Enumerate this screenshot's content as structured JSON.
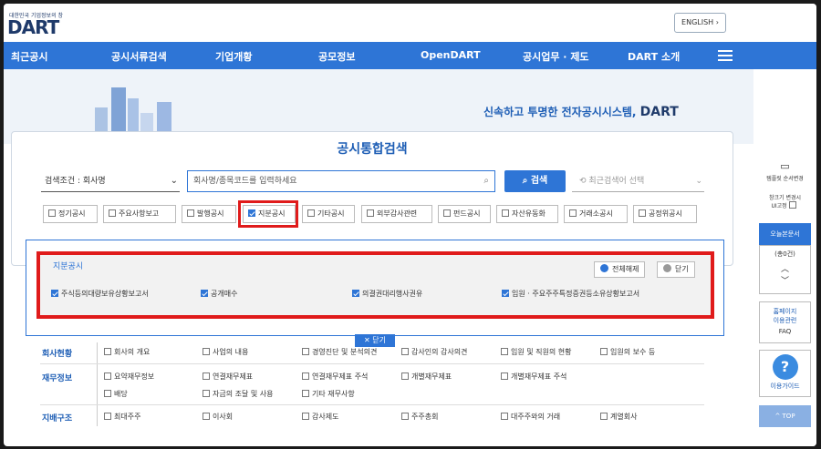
{
  "header": {
    "logo_sub": "대한민국 기업정보의 창",
    "logo": "DART",
    "english_label": "ENGLISH"
  },
  "nav": {
    "items": [
      "최근공시",
      "공시서류검색",
      "기업개황",
      "공모정보",
      "OpenDART",
      "공시업무 · 제도",
      "DART 소개"
    ]
  },
  "hero": {
    "tagline": "신속하고 투명한 전자공시시스템,",
    "tagline_brand": "DART"
  },
  "search": {
    "title": "공시통합검색",
    "condition": "검색조건 : 회사명",
    "placeholder": "회사명/종목코드를 입력하세요",
    "button": "검색",
    "recent": "최근검색어 선택"
  },
  "chips": [
    {
      "label": "정기공시",
      "checked": false
    },
    {
      "label": "주요사항보고",
      "checked": false
    },
    {
      "label": "발행공시",
      "checked": false
    },
    {
      "label": "지분공시",
      "checked": true
    },
    {
      "label": "기타공시",
      "checked": false
    },
    {
      "label": "외부감사관련",
      "checked": false
    },
    {
      "label": "펀드공시",
      "checked": false
    },
    {
      "label": "자산유동화",
      "checked": false
    },
    {
      "label": "거래소공시",
      "checked": false
    },
    {
      "label": "공정위공시",
      "checked": false
    }
  ],
  "sub_panel": {
    "title": "지분공시",
    "select_all": "전체해제",
    "close": "닫기",
    "items": [
      "주식등의대량보유상황보고서",
      "공개매수",
      "의결권대리행사권유",
      "임원 · 주요주주특정증권등소유상황보고서"
    ]
  },
  "close_label": "닫기",
  "grid": {
    "rows": [
      {
        "label": "회사현황",
        "items": [
          "회사의 개요",
          "사업의 내용",
          "경영진단 및 분석의견",
          "감사인의 감사의견",
          "임원 및 직원의 현황",
          "임원의 보수 등"
        ]
      },
      {
        "label": "재무정보",
        "items": [
          "요약재무정보",
          "연결재무제표",
          "연결재무제표 주석",
          "개별재무제표",
          "개별재무제표 주석",
          "배당",
          "자금의 조달 및 사용",
          "기타 재무사항"
        ]
      },
      {
        "label": "지배구조",
        "items": [
          "최대주주",
          "이사회",
          "감사제도",
          "주주총회",
          "대주주와의 거래",
          "계열회사"
        ]
      }
    ]
  },
  "side": {
    "template": "템플릿 순서변경",
    "window": "창크기 변경시",
    "ui_fixed": "UI고정",
    "today": "오늘본문서",
    "today_count": "(총0건)",
    "homepage1": "홈페이지",
    "homepage2": "이용관련",
    "faq": "FAQ",
    "guide": "이용가이드",
    "top": "TOP"
  }
}
